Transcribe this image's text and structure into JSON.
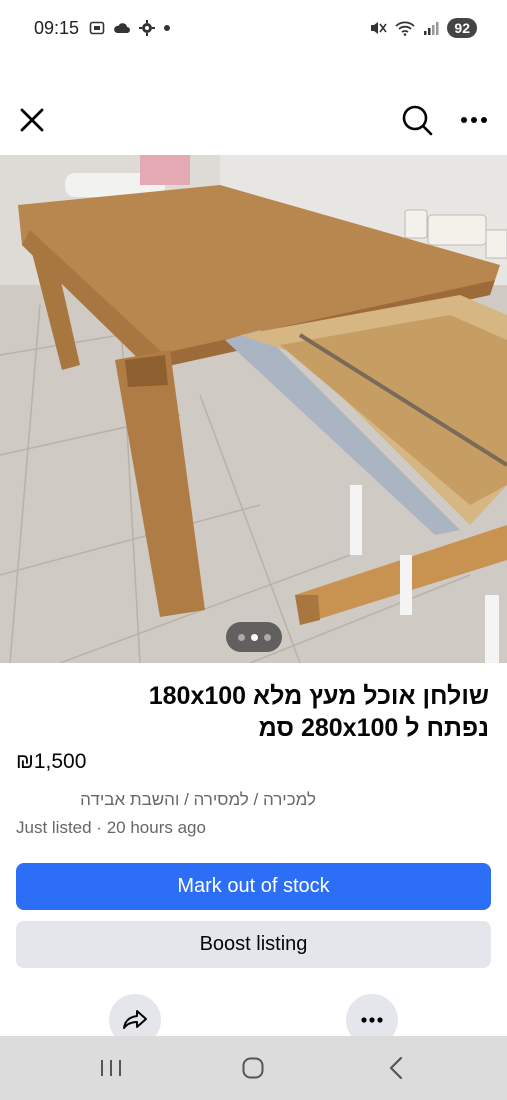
{
  "status_bar": {
    "time": "09:15",
    "battery": "92",
    "left_icons": [
      "screenshot-icon",
      "cloud-icon",
      "settings-cog-icon",
      "dot-icon"
    ],
    "right_icons": [
      "mute-icon",
      "wifi-icon",
      "signal-icon"
    ]
  },
  "header": {
    "close_icon": "close-icon",
    "search_icon": "search-icon",
    "more_icon": "more-horizontal-icon"
  },
  "photo": {
    "description_icon": "listing-photo",
    "dots_total": 3,
    "dots_active": 1
  },
  "listing": {
    "title_line1": "שולחן אוכל מעץ מלא 180x100",
    "title_line2": "נפתח ל 280x100 סמ",
    "price": "₪1,500",
    "category": "למכירה / למסירה / והשבת אבידה",
    "meta": "Just listed · 20 hours ago"
  },
  "actions": {
    "mark_out_of_stock": "Mark out of stock",
    "boost_listing": "Boost listing",
    "share_icon": "share-icon",
    "more_icon": "more-horizontal-icon"
  },
  "nav": {
    "recent_icon": "recent-apps-icon",
    "home_icon": "home-icon",
    "back_icon": "back-icon"
  },
  "colors": {
    "primary": "#2d6ef6",
    "secondary_bg": "#e4e6eb",
    "muted_text": "#65676b",
    "nav_bg": "#dcdcdc"
  }
}
